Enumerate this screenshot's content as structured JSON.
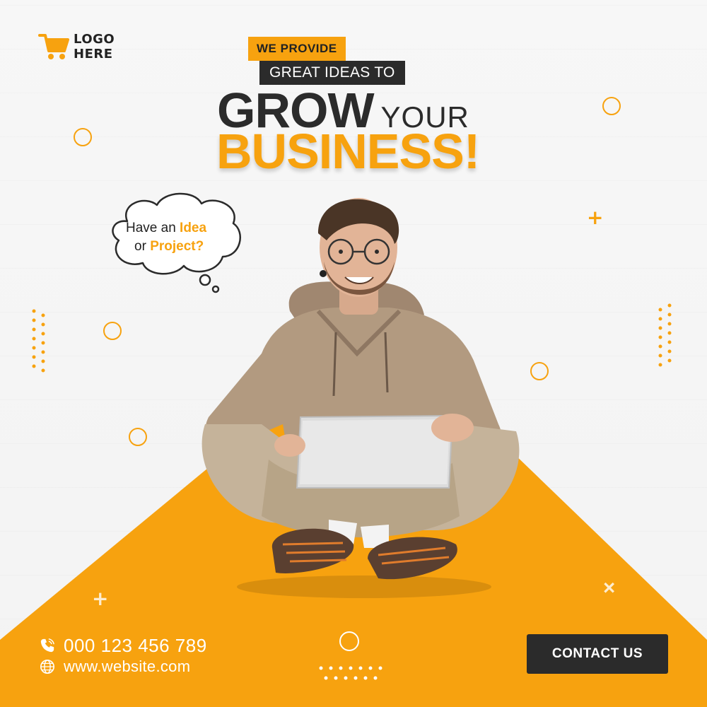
{
  "logo": {
    "line1": "LOGO",
    "line2": "HERE",
    "icon": "shopping-cart-icon"
  },
  "headline": {
    "tag_primary": "WE PROVIDE",
    "tag_secondary": "GREAT IDEAS TO",
    "grow": "GROW",
    "your": "YOUR",
    "business": "BUSINESS!"
  },
  "bubble": {
    "part1": "Have an ",
    "part1_highlight": "Idea",
    "part2": "or ",
    "part2_highlight": "Project?"
  },
  "contact": {
    "phone": "000 123 456 789",
    "phone_icon": "phone-icon",
    "website": "www.website.com",
    "website_icon": "globe-icon"
  },
  "cta": {
    "label": "CONTACT US"
  },
  "colors": {
    "accent": "#f7a20f",
    "dark": "#2b2b2b",
    "background": "#f5f5f5"
  }
}
